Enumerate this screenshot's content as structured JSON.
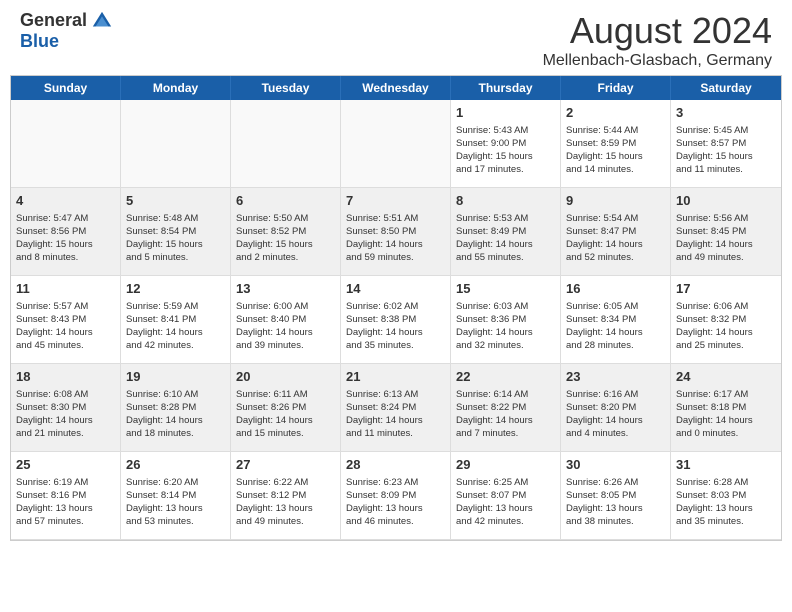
{
  "header": {
    "logo": {
      "general": "General",
      "blue": "Blue"
    },
    "title": "August 2024",
    "location": "Mellenbach-Glasbach, Germany"
  },
  "calendar": {
    "weekdays": [
      "Sunday",
      "Monday",
      "Tuesday",
      "Wednesday",
      "Thursday",
      "Friday",
      "Saturday"
    ],
    "weeks": [
      [
        {
          "day": "",
          "info": "",
          "empty": true
        },
        {
          "day": "",
          "info": "",
          "empty": true
        },
        {
          "day": "",
          "info": "",
          "empty": true
        },
        {
          "day": "",
          "info": "",
          "empty": true
        },
        {
          "day": "1",
          "info": "Sunrise: 5:43 AM\nSunset: 9:00 PM\nDaylight: 15 hours\nand 17 minutes."
        },
        {
          "day": "2",
          "info": "Sunrise: 5:44 AM\nSunset: 8:59 PM\nDaylight: 15 hours\nand 14 minutes."
        },
        {
          "day": "3",
          "info": "Sunrise: 5:45 AM\nSunset: 8:57 PM\nDaylight: 15 hours\nand 11 minutes."
        }
      ],
      [
        {
          "day": "4",
          "info": "Sunrise: 5:47 AM\nSunset: 8:56 PM\nDaylight: 15 hours\nand 8 minutes.",
          "shaded": true
        },
        {
          "day": "5",
          "info": "Sunrise: 5:48 AM\nSunset: 8:54 PM\nDaylight: 15 hours\nand 5 minutes.",
          "shaded": true
        },
        {
          "day": "6",
          "info": "Sunrise: 5:50 AM\nSunset: 8:52 PM\nDaylight: 15 hours\nand 2 minutes.",
          "shaded": true
        },
        {
          "day": "7",
          "info": "Sunrise: 5:51 AM\nSunset: 8:50 PM\nDaylight: 14 hours\nand 59 minutes.",
          "shaded": true
        },
        {
          "day": "8",
          "info": "Sunrise: 5:53 AM\nSunset: 8:49 PM\nDaylight: 14 hours\nand 55 minutes.",
          "shaded": true
        },
        {
          "day": "9",
          "info": "Sunrise: 5:54 AM\nSunset: 8:47 PM\nDaylight: 14 hours\nand 52 minutes.",
          "shaded": true
        },
        {
          "day": "10",
          "info": "Sunrise: 5:56 AM\nSunset: 8:45 PM\nDaylight: 14 hours\nand 49 minutes.",
          "shaded": true
        }
      ],
      [
        {
          "day": "11",
          "info": "Sunrise: 5:57 AM\nSunset: 8:43 PM\nDaylight: 14 hours\nand 45 minutes."
        },
        {
          "day": "12",
          "info": "Sunrise: 5:59 AM\nSunset: 8:41 PM\nDaylight: 14 hours\nand 42 minutes."
        },
        {
          "day": "13",
          "info": "Sunrise: 6:00 AM\nSunset: 8:40 PM\nDaylight: 14 hours\nand 39 minutes."
        },
        {
          "day": "14",
          "info": "Sunrise: 6:02 AM\nSunset: 8:38 PM\nDaylight: 14 hours\nand 35 minutes."
        },
        {
          "day": "15",
          "info": "Sunrise: 6:03 AM\nSunset: 8:36 PM\nDaylight: 14 hours\nand 32 minutes."
        },
        {
          "day": "16",
          "info": "Sunrise: 6:05 AM\nSunset: 8:34 PM\nDaylight: 14 hours\nand 28 minutes."
        },
        {
          "day": "17",
          "info": "Sunrise: 6:06 AM\nSunset: 8:32 PM\nDaylight: 14 hours\nand 25 minutes."
        }
      ],
      [
        {
          "day": "18",
          "info": "Sunrise: 6:08 AM\nSunset: 8:30 PM\nDaylight: 14 hours\nand 21 minutes.",
          "shaded": true
        },
        {
          "day": "19",
          "info": "Sunrise: 6:10 AM\nSunset: 8:28 PM\nDaylight: 14 hours\nand 18 minutes.",
          "shaded": true
        },
        {
          "day": "20",
          "info": "Sunrise: 6:11 AM\nSunset: 8:26 PM\nDaylight: 14 hours\nand 15 minutes.",
          "shaded": true
        },
        {
          "day": "21",
          "info": "Sunrise: 6:13 AM\nSunset: 8:24 PM\nDaylight: 14 hours\nand 11 minutes.",
          "shaded": true
        },
        {
          "day": "22",
          "info": "Sunrise: 6:14 AM\nSunset: 8:22 PM\nDaylight: 14 hours\nand 7 minutes.",
          "shaded": true
        },
        {
          "day": "23",
          "info": "Sunrise: 6:16 AM\nSunset: 8:20 PM\nDaylight: 14 hours\nand 4 minutes.",
          "shaded": true
        },
        {
          "day": "24",
          "info": "Sunrise: 6:17 AM\nSunset: 8:18 PM\nDaylight: 14 hours\nand 0 minutes.",
          "shaded": true
        }
      ],
      [
        {
          "day": "25",
          "info": "Sunrise: 6:19 AM\nSunset: 8:16 PM\nDaylight: 13 hours\nand 57 minutes."
        },
        {
          "day": "26",
          "info": "Sunrise: 6:20 AM\nSunset: 8:14 PM\nDaylight: 13 hours\nand 53 minutes."
        },
        {
          "day": "27",
          "info": "Sunrise: 6:22 AM\nSunset: 8:12 PM\nDaylight: 13 hours\nand 49 minutes."
        },
        {
          "day": "28",
          "info": "Sunrise: 6:23 AM\nSunset: 8:09 PM\nDaylight: 13 hours\nand 46 minutes."
        },
        {
          "day": "29",
          "info": "Sunrise: 6:25 AM\nSunset: 8:07 PM\nDaylight: 13 hours\nand 42 minutes."
        },
        {
          "day": "30",
          "info": "Sunrise: 6:26 AM\nSunset: 8:05 PM\nDaylight: 13 hours\nand 38 minutes."
        },
        {
          "day": "31",
          "info": "Sunrise: 6:28 AM\nSunset: 8:03 PM\nDaylight: 13 hours\nand 35 minutes."
        }
      ]
    ]
  }
}
